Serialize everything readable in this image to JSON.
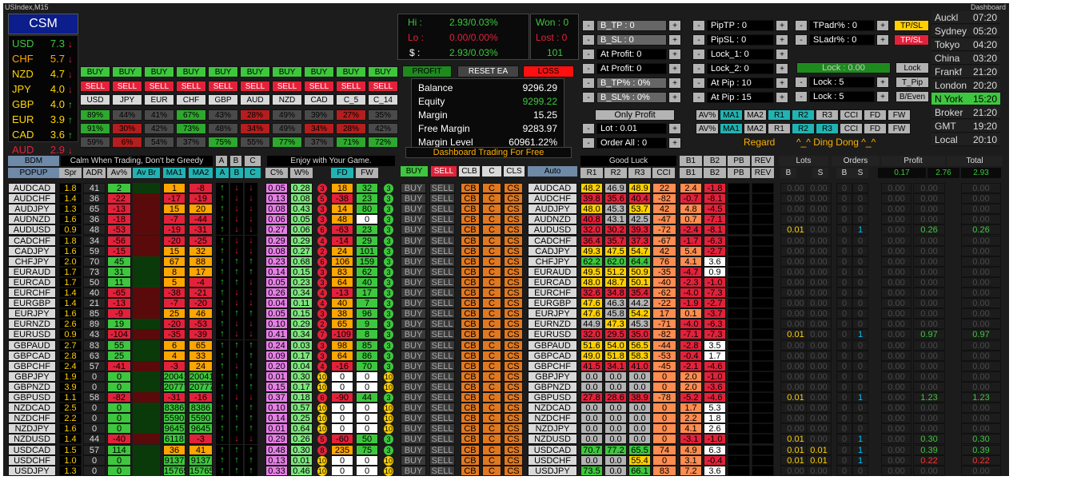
{
  "window": {
    "title": "USIndex,M15",
    "right": "Dashboard"
  },
  "csm": {
    "title": "CSM",
    "rows": [
      {
        "cur": "USD",
        "val": "7.3",
        "dir": "down",
        "color": "#3ec73e"
      },
      {
        "cur": "CHF",
        "val": "5.7",
        "dir": "down",
        "color": "#ffa500"
      },
      {
        "cur": "NZD",
        "val": "4.7",
        "dir": "down",
        "color": "#ffd800"
      },
      {
        "cur": "JPY",
        "val": "4.0",
        "dir": "down",
        "color": "#ffd800"
      },
      {
        "cur": "GBP",
        "val": "4.0",
        "dir": "up",
        "color": "#ffd800"
      },
      {
        "cur": "EUR",
        "val": "3.9",
        "dir": "up",
        "color": "#ffd800"
      },
      {
        "cur": "CAD",
        "val": "3.6",
        "dir": "up",
        "color": "#ffd800"
      },
      {
        "cur": "AUD",
        "val": "2.9",
        "dir": "down",
        "color": "#e2223a"
      }
    ]
  },
  "quick": {
    "buy": "BUY",
    "sell": "SELL",
    "curr": [
      "USD",
      "JPY",
      "EUR",
      "CHF",
      "GBP",
      "AUD",
      "NZD",
      "CAD",
      "C_5",
      "C_14"
    ],
    "p1": [
      [
        "89%",
        "g"
      ],
      [
        "44%",
        "d"
      ],
      [
        "41%",
        "d"
      ],
      [
        "67%",
        "g"
      ],
      [
        "43%",
        "d"
      ],
      [
        "28%",
        "r"
      ],
      [
        "49%",
        "d"
      ],
      [
        "39%",
        "d"
      ],
      [
        "27%",
        "r"
      ],
      [
        "35%",
        "d"
      ]
    ],
    "p2": [
      [
        "91%",
        "g"
      ],
      [
        "30%",
        "r"
      ],
      [
        "42%",
        "d"
      ],
      [
        "73%",
        "g"
      ],
      [
        "48%",
        "d"
      ],
      [
        "34%",
        "r"
      ],
      [
        "49%",
        "d"
      ],
      [
        "34%",
        "r"
      ],
      [
        "28%",
        "r"
      ],
      [
        "42%",
        "d"
      ]
    ],
    "p3": [
      [
        "59%",
        "d"
      ],
      [
        "6%",
        "r"
      ],
      [
        "54%",
        "d"
      ],
      [
        "37%",
        "d"
      ],
      [
        "75%",
        "g"
      ],
      [
        "55%",
        "d"
      ],
      [
        "77%",
        "g"
      ],
      [
        "37%",
        "d"
      ],
      [
        "71%",
        "g"
      ],
      [
        "72%",
        "g"
      ]
    ]
  },
  "hi": {
    "hi_l": "Hi :",
    "hi_v": "2.93/0.03%",
    "lo_l": "Lo :",
    "lo_v": "0.00/0.00%",
    "d_l": "$ :",
    "d_v": "2.93/0.03%",
    "won": "Won : 0",
    "lost": "Lost : 0",
    "num": "101"
  },
  "acct": {
    "profit": "PROFIT",
    "reset": "RESET EA",
    "loss": "LOSS",
    "rows": [
      [
        "Balance",
        "9296.29"
      ],
      [
        "Equity",
        "9299.22"
      ],
      [
        "Margin",
        "15.25"
      ],
      [
        "Free Margin",
        "9283.97"
      ],
      [
        "Margin Level",
        "60961.22%"
      ]
    ],
    "foot": "Dashboard Trading For Free"
  },
  "ctrl": {
    "c1": [
      "B_TP : 0",
      "B_SL : 0",
      "At Profit: 0",
      "At Profit: 0",
      "B_TP% : 0%",
      "B_SL% : 0%"
    ],
    "c2": [
      "PipTP : 0",
      "PipSL : 0",
      "Lock_1: 0",
      "Lock_2: 0",
      "At Pip : 10",
      "At Pip : 15"
    ],
    "tpadr": "TPadr% : 0",
    "sladr": "SLadr% : 0",
    "tpsl": "TP/SL",
    "tpsl2": "TP/SL",
    "lock_val": "Lock : 0.00",
    "lock_btn": "Lock",
    "lock5a": "Lock : 5",
    "lock5b": "Lock : 5",
    "tpip": "T_Pip",
    "beven": "B/Even",
    "only_profit": "Only Profit",
    "lot": "Lot : 0.01",
    "order_all": "Order All : 0",
    "ind1": [
      "AV%",
      "MA1",
      "MA2",
      "R1",
      "R2",
      "R3",
      "CCI",
      "FD",
      "FW"
    ],
    "ind2": [
      "AV%",
      "MA1",
      "MA2",
      "R1",
      "R2",
      "R3",
      "CCI",
      "FD",
      "FW"
    ],
    "regard": "Regard",
    "ding": "^_^ Ding Dong ^_^"
  },
  "sessions": [
    [
      "Auckl",
      "07:20"
    ],
    [
      "Sydney",
      "05:20"
    ],
    [
      "Tokyo",
      "04:20"
    ],
    [
      "China",
      "03:20"
    ],
    [
      "Frankf",
      "21:20"
    ],
    [
      "London",
      "20:20"
    ],
    [
      "N York",
      "15:20"
    ],
    [
      "Broker",
      "21:20"
    ],
    [
      "GMT",
      "19:20"
    ],
    [
      "Local",
      "20:10"
    ]
  ],
  "hdr": {
    "bdm": "BDM",
    "calm": "Calm When Trading, Don't be Greedy",
    "a": "A",
    "b": "B",
    "c": "C",
    "enjoy": "Enjoy with Your Game.",
    "popup": "POPUP",
    "spr": "Spr",
    "adr": "ADR",
    "avp": "Av%",
    "avbr": "Av Br",
    "ma1": "MA1",
    "ma2": "MA2",
    "cp": "C%",
    "wp": "W%",
    "fd": "FD",
    "fw": "FW",
    "buy": "BUY",
    "sell": "SELL",
    "clb": "CLB",
    "cc": "C",
    "cls": "CLS",
    "auto": "Auto",
    "goodluck": "Good Luck",
    "r1": "R1",
    "r2": "R2",
    "r3": "R3",
    "cci": "CCI",
    "b1": "B1",
    "b2": "B2",
    "pb": "PB",
    "rev": "REV",
    "lots": "Lots",
    "orders": "Orders",
    "profit": "Profit",
    "total": "Total",
    "bs_b": "B",
    "bs_s": "S",
    "ob": "B",
    "os": "S",
    "tot_p1": "0.17",
    "tot_p2": "2.76",
    "tot_t": "2.93"
  },
  "pairs": [
    {
      "p": "AUDCAD",
      "spr": "1.8",
      "adr": "41",
      "av": "2",
      "ma1": "1",
      "ma2": "-8",
      "u": "udd",
      "c": "0.05",
      "w": "0.28",
      "fdn": "3",
      "fd": "18",
      "fw": "32",
      "fwn": "3",
      "r1": "48.2",
      "r2": "46.9",
      "r3": "48.9",
      "cci": "22",
      "b1": "2.4",
      "b2": "-1.8"
    },
    {
      "p": "AUDCHF",
      "spr": "1.4",
      "adr": "36",
      "av": "-22",
      "ma1": "-17",
      "ma2": "-19",
      "u": "udd",
      "c": "0.13",
      "w": "0.08",
      "fdn": "5",
      "fd": "-38",
      "fw": "23",
      "fwn": "3",
      "r1": "39.8",
      "r2": "35.6",
      "r3": "40.4",
      "cci": "-82",
      "b1": "-0.7",
      "b2": "-8.1"
    },
    {
      "p": "AUDJPY",
      "spr": "1.3",
      "adr": "65",
      "av": "-13",
      "ma1": "15",
      "ma2": "20",
      "u": "udd",
      "c": "0.08",
      "w": "0.43",
      "fdn": "3",
      "fd": "14",
      "fw": "80",
      "fwn": "3",
      "r1": "48.0",
      "r2": "45.3",
      "r3": "53.7",
      "cci": "42",
      "b1": "4.8",
      "b2": "-4.5"
    },
    {
      "p": "AUDNZD",
      "spr": "1.6",
      "adr": "36",
      "av": "-18",
      "ma1": "-7",
      "ma2": "-44",
      "u": "udd",
      "c": "0.06",
      "w": "0.05",
      "fdn": "3",
      "fd": "48",
      "fw": "0",
      "fwn": "3",
      "r1": "40.8",
      "r2": "43.1",
      "r3": "42.5",
      "cci": "-47",
      "b1": "0.7",
      "b2": "-7.1"
    },
    {
      "p": "AUDUSD",
      "spr": "0.9",
      "adr": "48",
      "av": "-53",
      "ma1": "-19",
      "ma2": "-31",
      "u": "udd",
      "c": "0.27",
      "w": "0.06",
      "fdn": "6",
      "fd": "-63",
      "fw": "23",
      "fwn": "3",
      "r1": "32.0",
      "r2": "30.2",
      "r3": "39.3",
      "cci": "-72",
      "b1": "-2.4",
      "b2": "-8.1"
    },
    {
      "p": "CADCHF",
      "spr": "1.8",
      "adr": "34",
      "av": "-56",
      "ma1": "-20",
      "ma2": "-25",
      "u": "udd",
      "c": "0.29",
      "w": "0.29",
      "fdn": "4",
      "fd": "-14",
      "fw": "29",
      "fwn": "3",
      "r1": "36.4",
      "r2": "35.7",
      "r3": "37.3",
      "cci": "-67",
      "b1": "-1.7",
      "b2": "-6.3"
    },
    {
      "p": "CADJPY",
      "spr": "1.6",
      "adr": "59",
      "av": "-15",
      "ma1": "15",
      "ma2": "32",
      "u": "udd",
      "c": "0.08",
      "w": "0.27",
      "fdn": "2",
      "fd": "24",
      "fw": "101",
      "fwn": "3",
      "r1": "49.3",
      "r2": "47.5",
      "r3": "54.7",
      "cci": "42",
      "b1": "5.4",
      "b2": "-2.7"
    },
    {
      "p": "CHFJPY",
      "spr": "2.0",
      "adr": "70",
      "av": "45",
      "ma1": "67",
      "ma2": "88",
      "u": "uuu",
      "c": "0.23",
      "w": "0.68",
      "fdn": "6",
      "fd": "106",
      "fw": "159",
      "fwn": "3",
      "r1": "62.2",
      "r2": "62.0",
      "r3": "64.4",
      "cci": "76",
      "b1": "4.1",
      "b2": "3.6"
    },
    {
      "p": "EURAUD",
      "spr": "1.7",
      "adr": "73",
      "av": "31",
      "ma1": "8",
      "ma2": "17",
      "u": "uuu",
      "c": "0.14",
      "w": "0.15",
      "fdn": "3",
      "fd": "83",
      "fw": "62",
      "fwn": "3",
      "r1": "49.5",
      "r2": "51.2",
      "r3": "50.9",
      "cci": "-35",
      "b1": "-4.7",
      "b2": "0.9"
    },
    {
      "p": "EURCAD",
      "spr": "1.7",
      "adr": "50",
      "av": "11",
      "ma1": "5",
      "ma2": "-4",
      "u": "uud",
      "c": "0.05",
      "w": "0.23",
      "fdn": "3",
      "fd": "64",
      "fw": "40",
      "fwn": "3",
      "r1": "48.0",
      "r2": "48.7",
      "r3": "50.1",
      "cci": "-40",
      "b1": "-2.3",
      "b2": "-1.0"
    },
    {
      "p": "EURCHF",
      "spr": "1.4",
      "adr": "40",
      "av": "-65",
      "ma1": "-38",
      "ma2": "-21",
      "u": "udd",
      "c": "0.26",
      "w": "0.34",
      "fdn": "4",
      "fd": "-13",
      "fw": "17",
      "fwn": "3",
      "r1": "32.6",
      "r2": "34.8",
      "r3": "35.4",
      "cci": "-62",
      "b1": "-4.0",
      "b2": "-7.3"
    },
    {
      "p": "EURGBP",
      "spr": "1.4",
      "adr": "21",
      "av": "-13",
      "ma1": "-7",
      "ma2": "-20",
      "u": "udd",
      "c": "0.04",
      "w": "0.11",
      "fdn": "4",
      "fd": "40",
      "fw": "7",
      "fwn": "3",
      "r1": "47.6",
      "r2": "46.3",
      "r3": "44.2",
      "cci": "-22",
      "b1": "-1.9",
      "b2": "-2.7"
    },
    {
      "p": "EURJPY",
      "spr": "1.6",
      "adr": "85",
      "av": "-9",
      "ma1": "25",
      "ma2": "46",
      "u": "uuu",
      "c": "0.05",
      "w": "0.15",
      "fdn": "3",
      "fd": "38",
      "fw": "96",
      "fwn": "3",
      "r1": "47.6",
      "r2": "45.8",
      "r3": "54.2",
      "cci": "17",
      "b1": "0.1",
      "b2": "-3.7"
    },
    {
      "p": "EURNZD",
      "spr": "2.6",
      "adr": "89",
      "av": "19",
      "ma1": "-20",
      "ma2": "-53",
      "u": "udd",
      "c": "0.10",
      "w": "0.29",
      "fdn": "2",
      "fd": "65",
      "fw": "9",
      "fwn": "3",
      "r1": "44.9",
      "r2": "47.3",
      "r3": "45.3",
      "cci": "-71",
      "b1": "-4.0",
      "b2": "-6.3"
    },
    {
      "p": "EURUSD",
      "spr": "0.9",
      "adr": "43",
      "av": "-104",
      "ma1": "-35",
      "ma2": "-39",
      "u": "udd",
      "c": "0.41",
      "w": "0.34",
      "fdn": "7",
      "fd": "-109",
      "fw": "8",
      "fwn": "3",
      "r1": "32.0",
      "r2": "29.5",
      "r3": "35.0",
      "cci": "-82",
      "b1": "-7.1",
      "b2": "-7.3"
    },
    {
      "p": "GBPAUD",
      "spr": "2.7",
      "adr": "83",
      "av": "55",
      "ma1": "6",
      "ma2": "65",
      "u": "uuu",
      "c": "0.24",
      "w": "0.03",
      "fdn": "3",
      "fd": "98",
      "fw": "85",
      "fwn": "3",
      "r1": "51.6",
      "r2": "54.0",
      "r3": "56.5",
      "cci": "-44",
      "b1": "-2.8",
      "b2": "3.5"
    },
    {
      "p": "GBPCAD",
      "spr": "2.8",
      "adr": "63",
      "av": "25",
      "ma1": "4",
      "ma2": "33",
      "u": "uuu",
      "c": "0.09",
      "w": "0.17",
      "fdn": "3",
      "fd": "64",
      "fw": "86",
      "fwn": "3",
      "r1": "49.0",
      "r2": "51.8",
      "r3": "58.3",
      "cci": "-53",
      "b1": "-0.4",
      "b2": "1.7"
    },
    {
      "p": "GBPCHF",
      "spr": "2.4",
      "adr": "57",
      "av": "-41",
      "ma1": "-3",
      "ma2": "24",
      "u": "udu",
      "c": "0.20",
      "w": "0.04",
      "fdn": "4",
      "fd": "-16",
      "fw": "70",
      "fwn": "3",
      "r1": "41.5",
      "r2": "34.1",
      "r3": "41.0",
      "cci": "-45",
      "b1": "-2.1",
      "b2": "-4.6"
    },
    {
      "p": "GBPJPY",
      "spr": "1.9",
      "adr": "0",
      "av": "0",
      "ma1": "20041",
      "ma2": "20041",
      "u": "uuu",
      "c": "0.01",
      "w": "0.30",
      "fdn": "10",
      "fd": "0",
      "fw": "0",
      "fwn": "10",
      "r1": "0.0",
      "r2": "0.0",
      "r3": "0.0",
      "cci": "0",
      "b1": "2.0",
      "b2": "-1.0"
    },
    {
      "p": "GBPNZD",
      "spr": "3.9",
      "adr": "0",
      "av": "0",
      "ma1": "20777",
      "ma2": "20777",
      "u": "uuu",
      "c": "0.15",
      "w": "0.17",
      "fdn": "10",
      "fd": "0",
      "fw": "0",
      "fwn": "10",
      "r1": "0.0",
      "r2": "0.0",
      "r3": "0.0",
      "cci": "0",
      "b1": "2.0",
      "b2": "-3.6"
    },
    {
      "p": "GBPUSD",
      "spr": "1.1",
      "adr": "58",
      "av": "-82",
      "ma1": "-31",
      "ma2": "-16",
      "u": "udd",
      "c": "0.37",
      "w": "0.18",
      "fdn": "6",
      "fd": "-90",
      "fw": "44",
      "fwn": "3",
      "r1": "27.8",
      "r2": "28.6",
      "r3": "38.9",
      "cci": "-78",
      "b1": "-5.2",
      "b2": "-4.6"
    },
    {
      "p": "NZDCAD",
      "spr": "2.5",
      "adr": "0",
      "av": "0",
      "ma1": "8386",
      "ma2": "8386",
      "u": "uuu",
      "c": "0.10",
      "w": "0.57",
      "fdn": "10",
      "fd": "0",
      "fw": "0",
      "fwn": "10",
      "r1": "0.0",
      "r2": "0.0",
      "r3": "0.0",
      "cci": "0",
      "b1": "1.7",
      "b2": "5.3"
    },
    {
      "p": "NZDCHF",
      "spr": "2.2",
      "adr": "0",
      "av": "0",
      "ma1": "5590",
      "ma2": "5590",
      "u": "uuu",
      "c": "0.14",
      "w": "0.25",
      "fdn": "10",
      "fd": "0",
      "fw": "0",
      "fwn": "10",
      "r1": "0.0",
      "r2": "0.0",
      "r3": "0.0",
      "cci": "0",
      "b1": "2.2",
      "b2": "1.8"
    },
    {
      "p": "NZDJPY",
      "spr": "1.6",
      "adr": "0",
      "av": "0",
      "ma1": "9645",
      "ma2": "9645",
      "u": "uuu",
      "c": "0.01",
      "w": "0.64",
      "fdn": "10",
      "fd": "0",
      "fw": "0",
      "fwn": "10",
      "r1": "0.0",
      "r2": "0.0",
      "r3": "0.0",
      "cci": "0",
      "b1": "4.1",
      "b2": "2.6"
    },
    {
      "p": "NZDUSD",
      "spr": "1.4",
      "adr": "44",
      "av": "-40",
      "ma1": "6118",
      "ma2": "-3",
      "u": "udd",
      "c": "0.29",
      "w": "0.26",
      "fdn": "5",
      "fd": "-60",
      "fw": "50",
      "fwn": "3",
      "r1": "0.0",
      "r2": "0.0",
      "r3": "0.0",
      "cci": "0",
      "b1": "-3.1",
      "b2": "-1.0"
    },
    {
      "p": "USDCAD",
      "spr": "1.5",
      "adr": "57",
      "av": "114",
      "ma1": "36",
      "ma2": "41",
      "u": "uuu",
      "c": "0.48",
      "w": "0.30",
      "fdn": "8",
      "fd": "235",
      "fw": "75",
      "fwn": "3",
      "r1": "70.7",
      "r2": "77.2",
      "r3": "65.5",
      "cci": "74",
      "b1": "4.9",
      "b2": "6.3"
    },
    {
      "p": "USDCHF",
      "spr": "1.0",
      "adr": "0",
      "av": "0",
      "ma1": "9137",
      "ma2": "9137",
      "u": "uuu",
      "c": "0.13",
      "w": "0.01",
      "fdn": "10",
      "fd": "0",
      "fw": "0",
      "fwn": "10",
      "r1": "0.0",
      "r2": "0.0",
      "r3": "55.4",
      "cci": "0",
      "b1": "3.1",
      "b2": "-0.4"
    },
    {
      "p": "USDJPY",
      "spr": "1.3",
      "adr": "0",
      "av": "0",
      "ma1": "15765",
      "ma2": "15765",
      "u": "uuu",
      "c": "0.33",
      "w": "0.46",
      "fdn": "10",
      "fd": "0",
      "fw": "0",
      "fwn": "10",
      "r1": "73.5",
      "r2": "0.0",
      "r3": "66.1",
      "cci": "83",
      "b1": "7.2",
      "b2": "3.6"
    }
  ],
  "trades": {
    "lots_b": {
      "4": "0.01",
      "14": "0.01",
      "20": "0.01",
      "24": "0.01",
      "25": "0.01",
      "26": "0.01"
    },
    "lots_s": {
      "25": "0.01",
      "26": "0.01"
    },
    "ord_b": {
      "4": "1",
      "14": "1",
      "20": "1",
      "24": "1",
      "25": "1",
      "26": "1"
    },
    "prof": {
      "4": "0.26",
      "14": "0.97",
      "20": "1.23",
      "24": "0.30",
      "25": "0.39",
      "26": "0.22"
    },
    "tot": {
      "4": "0.26",
      "14": "0.97",
      "20": "1.23",
      "24": "0.30",
      "25": "0.39",
      "26": "0.22"
    }
  },
  "zero": "0.00",
  "zeroi": "0",
  "btn": {
    "buy": "BUY",
    "sell": "SELL",
    "cb": "CB",
    "c": "C",
    "cs": "CS",
    "plus": "+",
    "minus": "-"
  }
}
